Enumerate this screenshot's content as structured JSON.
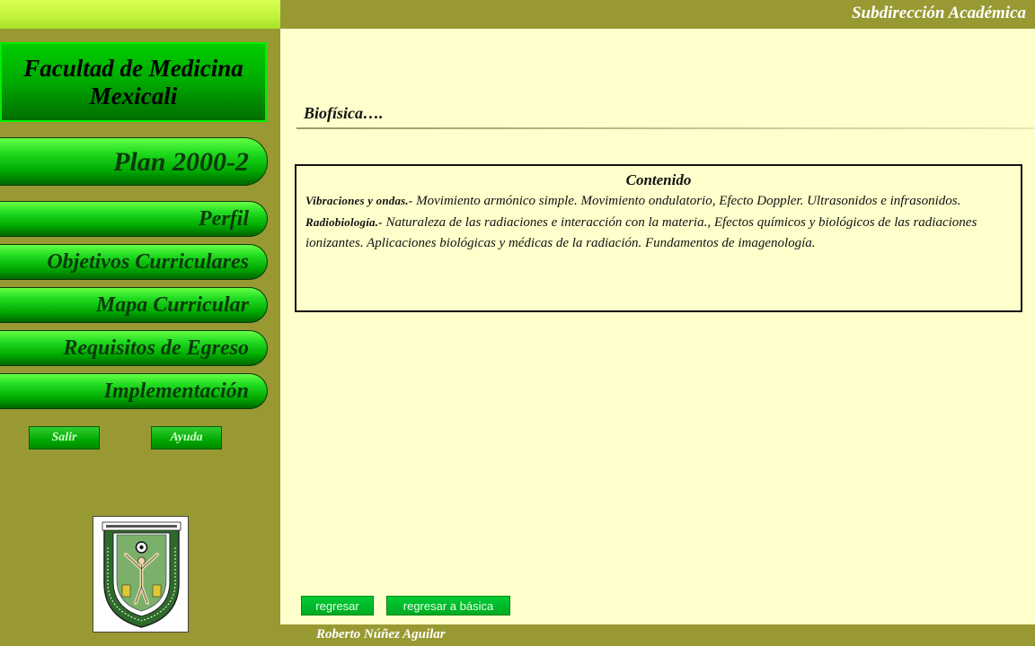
{
  "header": {
    "title": "Subdirección Académica"
  },
  "sidebar": {
    "faculty_line1": "Facultad de Medicina",
    "faculty_line2": "Mexicali",
    "plan": "Plan 2000-2",
    "nav": [
      {
        "label": "Perfil"
      },
      {
        "label": "Objetivos Curriculares"
      },
      {
        "label": "Mapa Curricular"
      },
      {
        "label": "Requisitos de Egreso"
      },
      {
        "label": "Implementación"
      }
    ],
    "exit_label": "Salir",
    "help_label": "Ayuda",
    "seal_icon": "university-seal-icon"
  },
  "main": {
    "heading": "Biofísica….",
    "box_title": "Contenido",
    "items": [
      {
        "term": "Vibraciones y ondas.-",
        "desc": " Movimiento armónico simple. Movimiento ondulatorio, Efecto Doppler. Ultrasonidos e infrasonidos."
      },
      {
        "term": "Radiobiología.-",
        "desc": " Naturaleza de las radiaciones e interacción con la materia., Efectos químicos y biológicos de las radiaciones ionizantes. Aplicaciones biológicas y médicas de la radiación. Fundamentos de imagenología."
      }
    ],
    "back_label": "regresar",
    "back_basic_label": "regresar a básica"
  },
  "footer": {
    "author": "Roberto Núñez Aguilar"
  },
  "colors": {
    "page_bg": "#999933",
    "panel_bg": "#ffffcc",
    "nav_green": "#00aa00"
  }
}
